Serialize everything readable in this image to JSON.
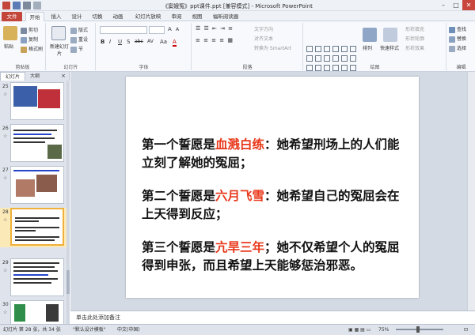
{
  "window": {
    "title": "《窦娥冤》ppt课件.ppt [兼容模式] - Microsoft PowerPoint",
    "minimize": "–",
    "maximize": "□",
    "close": "✕"
  },
  "tabs": [
    "文件",
    "开始",
    "插入",
    "设计",
    "切换",
    "动画",
    "幻灯片放映",
    "审阅",
    "视图",
    "福昕阅读器"
  ],
  "ribbon": {
    "clipboard": {
      "paste": "粘贴",
      "cut": "剪切",
      "copy": "复制",
      "format_painter": "格式刷",
      "label": "剪贴板"
    },
    "slides": {
      "new_slide": "新建幻灯片",
      "layout": "版式",
      "reset": "重设",
      "section": "节",
      "label": "幻灯片"
    },
    "font": {
      "bold": "B",
      "italic": "I",
      "underline": "U",
      "shadow": "S",
      "strike": "abc",
      "spacing": "AV",
      "case": "Aa",
      "color": "A",
      "label": "字体"
    },
    "paragraph": {
      "text_direction": "文字方向",
      "align_text": "对齐文本",
      "smartart": "转换为 SmartArt",
      "label": "段落"
    },
    "drawing": {
      "arrange": "排列",
      "quick_styles": "快速样式",
      "fill": "形状填充",
      "outline": "形状轮廓",
      "effects": "形状效果",
      "label": "绘图"
    },
    "editing": {
      "find": "查找",
      "replace": "替换",
      "select": "选择",
      "label": "编辑"
    }
  },
  "left_pane": {
    "tab_slides": "幻灯片",
    "tab_outline": "大纲",
    "close": "×",
    "star": "☆",
    "thumbs": [
      {
        "num": "25"
      },
      {
        "num": "26"
      },
      {
        "num": "27"
      },
      {
        "num": "28"
      },
      {
        "num": "29"
      },
      {
        "num": "30"
      }
    ]
  },
  "slide": {
    "p1_a": "第一个誓愿是",
    "p1_hl": "血溅白练",
    "p1_b": "：她希望刑场上的人们能立刻了解她的冤屈；",
    "p2_a": "第二个誓愿是",
    "p2_hl": "六月飞雪",
    "p2_b": "：她希望自己的冤屈会在上天得到反应；",
    "p3_a": "第三个誓愿是",
    "p3_hl": "亢旱三年",
    "p3_b": "；她不仅希望个人的冤屈得到申张，而且希望上天能够惩治邪恶。"
  },
  "notes_placeholder": "单击此处添加备注",
  "status": {
    "slide_info": "幻灯片 第 28 张，共 34 张",
    "theme": "\"默认设计模板\"",
    "language": "中文(中国)",
    "zoom": "75%"
  },
  "colors": {
    "accent": "#c4453a",
    "highlight_text": "#e8381a"
  }
}
